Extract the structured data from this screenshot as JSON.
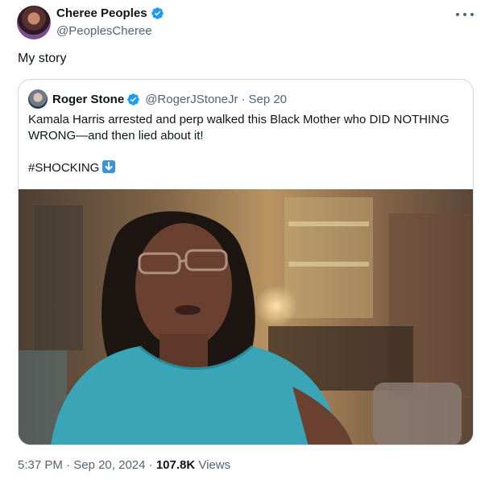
{
  "tweet": {
    "author_name": "Cheree Peoples",
    "author_handle": "@PeoplesCheree",
    "text": "My story"
  },
  "quote": {
    "author_name": "Roger Stone",
    "author_handle": "@RogerJStoneJr",
    "separator": "·",
    "date": "Sep 20",
    "line1": "Kamala Harris arrested and perp walked this Black Mother who DID NOTHING WRONG—and then lied about it!",
    "hashtag": "#SHOCKING"
  },
  "meta": {
    "time": "5:37 PM",
    "date": "Sep 20, 2024",
    "separator": "·",
    "views_count": "107.8K",
    "views_label": "Views"
  },
  "colors": {
    "verified": "#1d9bf0",
    "secondary_text": "#536471",
    "border": "#cfd9de"
  }
}
